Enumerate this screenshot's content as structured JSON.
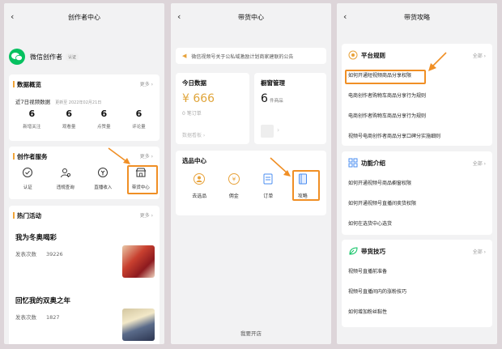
{
  "p1": {
    "title": "创作者中心",
    "account": {
      "name": "微信创作者",
      "badge": "认证"
    },
    "overview": {
      "title": "数据概览",
      "more": "更多 ›",
      "period": "近7日视频数据",
      "update": "更新至 2022年02月21日",
      "stats": [
        {
          "v": "6",
          "l": "新增关注"
        },
        {
          "v": "6",
          "l": "观看量"
        },
        {
          "v": "6",
          "l": "点赞量"
        },
        {
          "v": "6",
          "l": "评论量"
        }
      ]
    },
    "services": {
      "title": "创作者服务",
      "more": "更多 ›",
      "items": [
        "认证",
        "违规查询",
        "直播收入",
        "带货中心"
      ]
    },
    "activities": {
      "title": "热门活动",
      "more": "更多 ›",
      "items": [
        {
          "title": "我为冬奥喝彩",
          "label": "发表次数",
          "count": "39226"
        },
        {
          "title": "回忆我的双奥之年",
          "label": "发表次数",
          "count": "1827"
        }
      ]
    }
  },
  "p2": {
    "title": "带货中心",
    "notice": "微信视频号关于公私域激励计划商家建联的公告",
    "today": {
      "title": "今日数据",
      "amount": "¥ 666",
      "orders": "0 笔订单",
      "link": "数据看板 ›"
    },
    "window": {
      "title": "橱窗管理",
      "count": "6",
      "unit": "件商品"
    },
    "select": {
      "title": "选品中心",
      "items": [
        "去选品",
        "佣金",
        "订单",
        "攻略"
      ]
    },
    "footer": "我要开店"
  },
  "p3": {
    "title": "带货攻略",
    "sections": [
      {
        "title": "平台规则",
        "more": "全部 ›",
        "items": [
          "如何开通短视频商品分享权限",
          "电商创作者购物车商品分享行为规则",
          "电商创作者购物车商品分享行为规则",
          "视频号电商创作者商品分享口碑分实施细则"
        ]
      },
      {
        "title": "功能介绍",
        "more": "全部 ›",
        "items": [
          "如何开通视频号商品橱窗权限",
          "如何开通视频号直播间卖货权限",
          "如何在选货中心选货"
        ]
      },
      {
        "title": "带货技巧",
        "more": "全部 ›",
        "items": [
          "视频号直播前准备",
          "视频号直播间内的涨粉技巧",
          "如何增加粉丝黏性"
        ]
      }
    ]
  },
  "colors": {
    "accent": "#f08f25",
    "green": "#07c160",
    "gold": "#e0a53b",
    "link_blue": "#4a8df0"
  }
}
